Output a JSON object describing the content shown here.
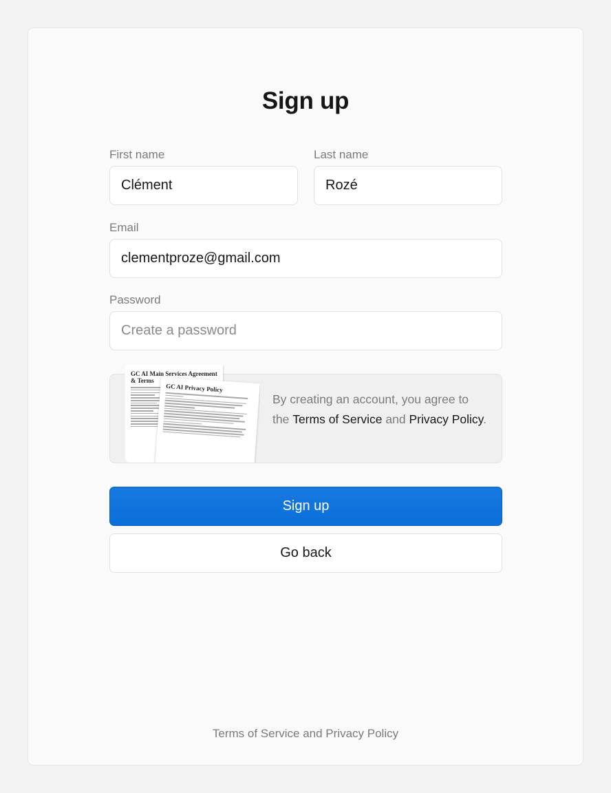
{
  "signup": {
    "title": "Sign up",
    "first_name": {
      "label": "First name",
      "value": "Clément"
    },
    "last_name": {
      "label": "Last name",
      "value": "Rozé"
    },
    "email": {
      "label": "Email",
      "value": "clementproze@gmail.com"
    },
    "password": {
      "label": "Password",
      "placeholder": "Create a password",
      "value": ""
    },
    "agreement": {
      "prefix": "By creating an account, you agree to the",
      "terms_link": "Terms of Service",
      "conjunction": "and",
      "privacy_link": "Privacy Policy",
      "suffix": "."
    },
    "documents": {
      "doc1_title": "GC AI Main Services Agreement & Terms",
      "doc2_title": "GC AI Privacy Policy"
    },
    "signup_button": "Sign up",
    "back_button": "Go back",
    "footer_link": "Terms of Service and Privacy Policy"
  }
}
